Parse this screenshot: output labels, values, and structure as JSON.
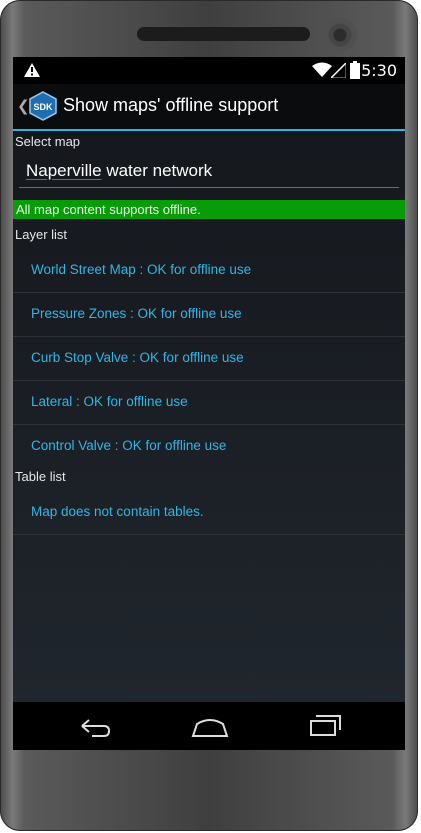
{
  "status_bar": {
    "time": "5:30",
    "icons": [
      "warning-icon",
      "wifi-icon",
      "signal-icon",
      "battery-icon"
    ]
  },
  "action_bar": {
    "icon_text": "SDK",
    "title": "Show maps' offline support"
  },
  "select_map": {
    "label": "Select map",
    "value_word1": "Naperville",
    "value_rest": " water network"
  },
  "offline_status": "All map content supports offline.",
  "layer_list": {
    "label": "Layer list",
    "items": [
      "World Street Map : OK for offline use",
      "Pressure Zones : OK for offline use",
      "Curb Stop Valve : OK for offline use",
      "Lateral : OK for offline use",
      "Control Valve : OK for offline use"
    ]
  },
  "table_list": {
    "label": "Table list",
    "items": [
      "Map does not contain tables."
    ]
  },
  "colors": {
    "accent": "#33b5e5",
    "banner": "#089d08"
  },
  "nav_bar": [
    "back-icon",
    "home-icon",
    "recent-apps-icon"
  ]
}
